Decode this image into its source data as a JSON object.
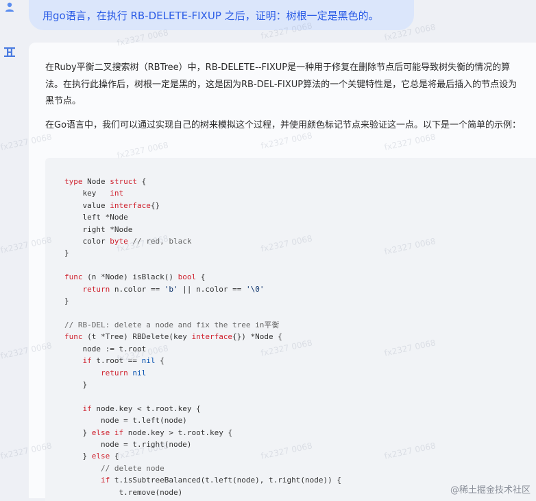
{
  "user_message": {
    "text": "用go语言，在执行 RB-DELETE-FIXUP 之后，证明：树根一定是黑色的。"
  },
  "answer": {
    "paragraph1": "在Ruby平衡二叉搜索树（RBTree）中，RB-DELETE--FIXUP是一种用于修复在删除节点后可能导致树失衡的情况的算法。在执行此操作后，树根一定是黑的，这是因为RB-DEL-FIXUP算法的一个关键特性是，它总是将最后插入的节点设为黑节点。",
    "paragraph2": "在Go语言中，我们可以通过实现自己的树来模拟这个过程，并使用颜色标记节点来验证这一点。以下是一个简单的示例：",
    "code_lines": [
      "type Node struct {",
      "    key   int",
      "    value interface{}",
      "    left *Node",
      "    right *Node",
      "    color byte // red, black",
      "}",
      "",
      "func (n *Node) isBlack() bool {",
      "    return n.color == 'b' || n.color == '\\0'",
      "}",
      "",
      "// RB-DEL: delete a node and fix the tree in平衡",
      "func (t *Tree) RBDelete(key interface{}) *Node {",
      "    node := t.root",
      "    if t.root == nil {",
      "        return nil",
      "    }",
      "",
      "    if node.key < t.root.key {",
      "        node = t.left(node)",
      "    } else if node.key > t.root.key {",
      "        node = t.right(node)",
      "    } else {",
      "        // delete node",
      "        if t.isSubtreeBalanced(t.left(node), t.right(node)) {",
      "            t.remove(node)"
    ]
  },
  "watermark_text": "fx2327 0068",
  "footer_brand": "@稀土掘金技术社区",
  "colors": {
    "user_bubble_bg": "#dbe6fb",
    "user_text": "#2b5ce6",
    "keyword": "#cf222e"
  },
  "icons": {
    "user": "user-icon",
    "bot": "bot-logo-icon"
  }
}
